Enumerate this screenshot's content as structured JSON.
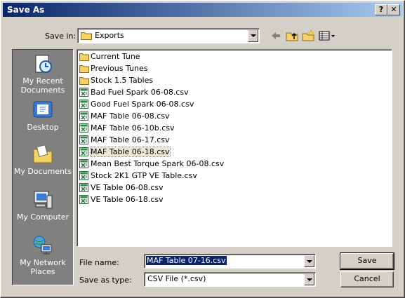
{
  "window": {
    "title": "Save As",
    "help_label": "?",
    "close_label": "✕"
  },
  "save_in": {
    "label": "Save in:",
    "value": "Exports"
  },
  "places": [
    {
      "label": "My Recent Documents"
    },
    {
      "label": "Desktop"
    },
    {
      "label": "My Documents"
    },
    {
      "label": "My Computer"
    },
    {
      "label": "My Network Places"
    }
  ],
  "files": [
    {
      "name": "Current Tune",
      "type": "folder"
    },
    {
      "name": "Previous Tunes",
      "type": "folder"
    },
    {
      "name": "Stock 1.5 Tables",
      "type": "folder"
    },
    {
      "name": "Bad Fuel Spark 06-08.csv",
      "type": "csv"
    },
    {
      "name": "Good Fuel Spark 06-08.csv",
      "type": "csv"
    },
    {
      "name": "MAF Table 06-08.csv",
      "type": "csv"
    },
    {
      "name": "MAF Table 06-10b.csv",
      "type": "csv"
    },
    {
      "name": "MAF Table 06-17.csv",
      "type": "csv"
    },
    {
      "name": "MAF Table 06-18.csv",
      "type": "csv",
      "selected": true
    },
    {
      "name": "Mean Best Torque Spark 06-08.csv",
      "type": "csv"
    },
    {
      "name": "Stock 2K1 GTP VE Table.csv",
      "type": "csv"
    },
    {
      "name": "VE Table 06-08.csv",
      "type": "csv"
    },
    {
      "name": "VE Table 06-18.csv",
      "type": "csv"
    }
  ],
  "file_name": {
    "label": "File name:",
    "value": "MAF Table 07-16.csv"
  },
  "save_as_type": {
    "label": "Save as type:",
    "value": "CSV File (*.csv)"
  },
  "buttons": {
    "save": "Save",
    "cancel": "Cancel"
  }
}
